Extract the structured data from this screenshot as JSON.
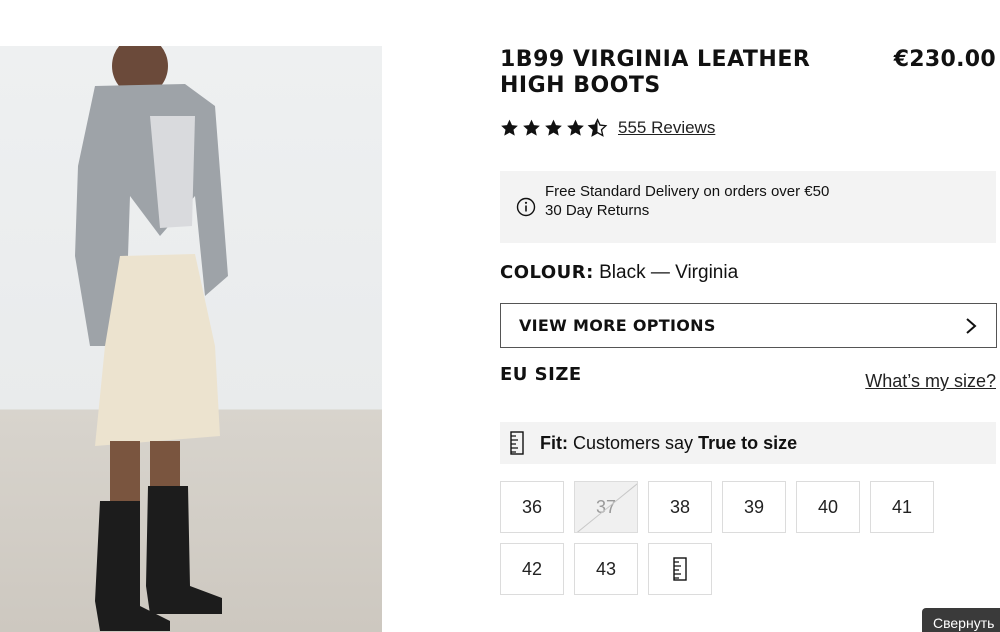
{
  "product": {
    "title": "1B99 VIRGINIA LEATHER HIGH BOOTS",
    "price": "€230.00",
    "rating": 4.5,
    "reviews_label": "555 Reviews"
  },
  "delivery": {
    "line1": "Free Standard Delivery on orders over €50",
    "line2": "30 Day Returns",
    "icon": "info-icon"
  },
  "colour": {
    "label": "COLOUR:",
    "value": "Black — Virginia"
  },
  "view_more": {
    "label": "VIEW MORE OPTIONS",
    "icon": "chevron-right-icon"
  },
  "size": {
    "heading": "EU SIZE",
    "guide_link": "What’s my size?",
    "fit_label": "Fit:",
    "fit_text": "Customers say",
    "fit_value": "True to size",
    "options": [
      {
        "label": "36",
        "available": true
      },
      {
        "label": "37",
        "available": false
      },
      {
        "label": "38",
        "available": true
      },
      {
        "label": "39",
        "available": true
      },
      {
        "label": "40",
        "available": true
      },
      {
        "label": "41",
        "available": true
      },
      {
        "label": "42",
        "available": true
      },
      {
        "label": "43",
        "available": true
      }
    ],
    "guide_icon": "ruler-icon"
  },
  "collapse_tab": "Свернуть",
  "colors": {
    "text": "#111111",
    "panel_bg": "#f3f3f3",
    "border": "#dcdcdc",
    "tab_bg": "#3a3a3a"
  }
}
